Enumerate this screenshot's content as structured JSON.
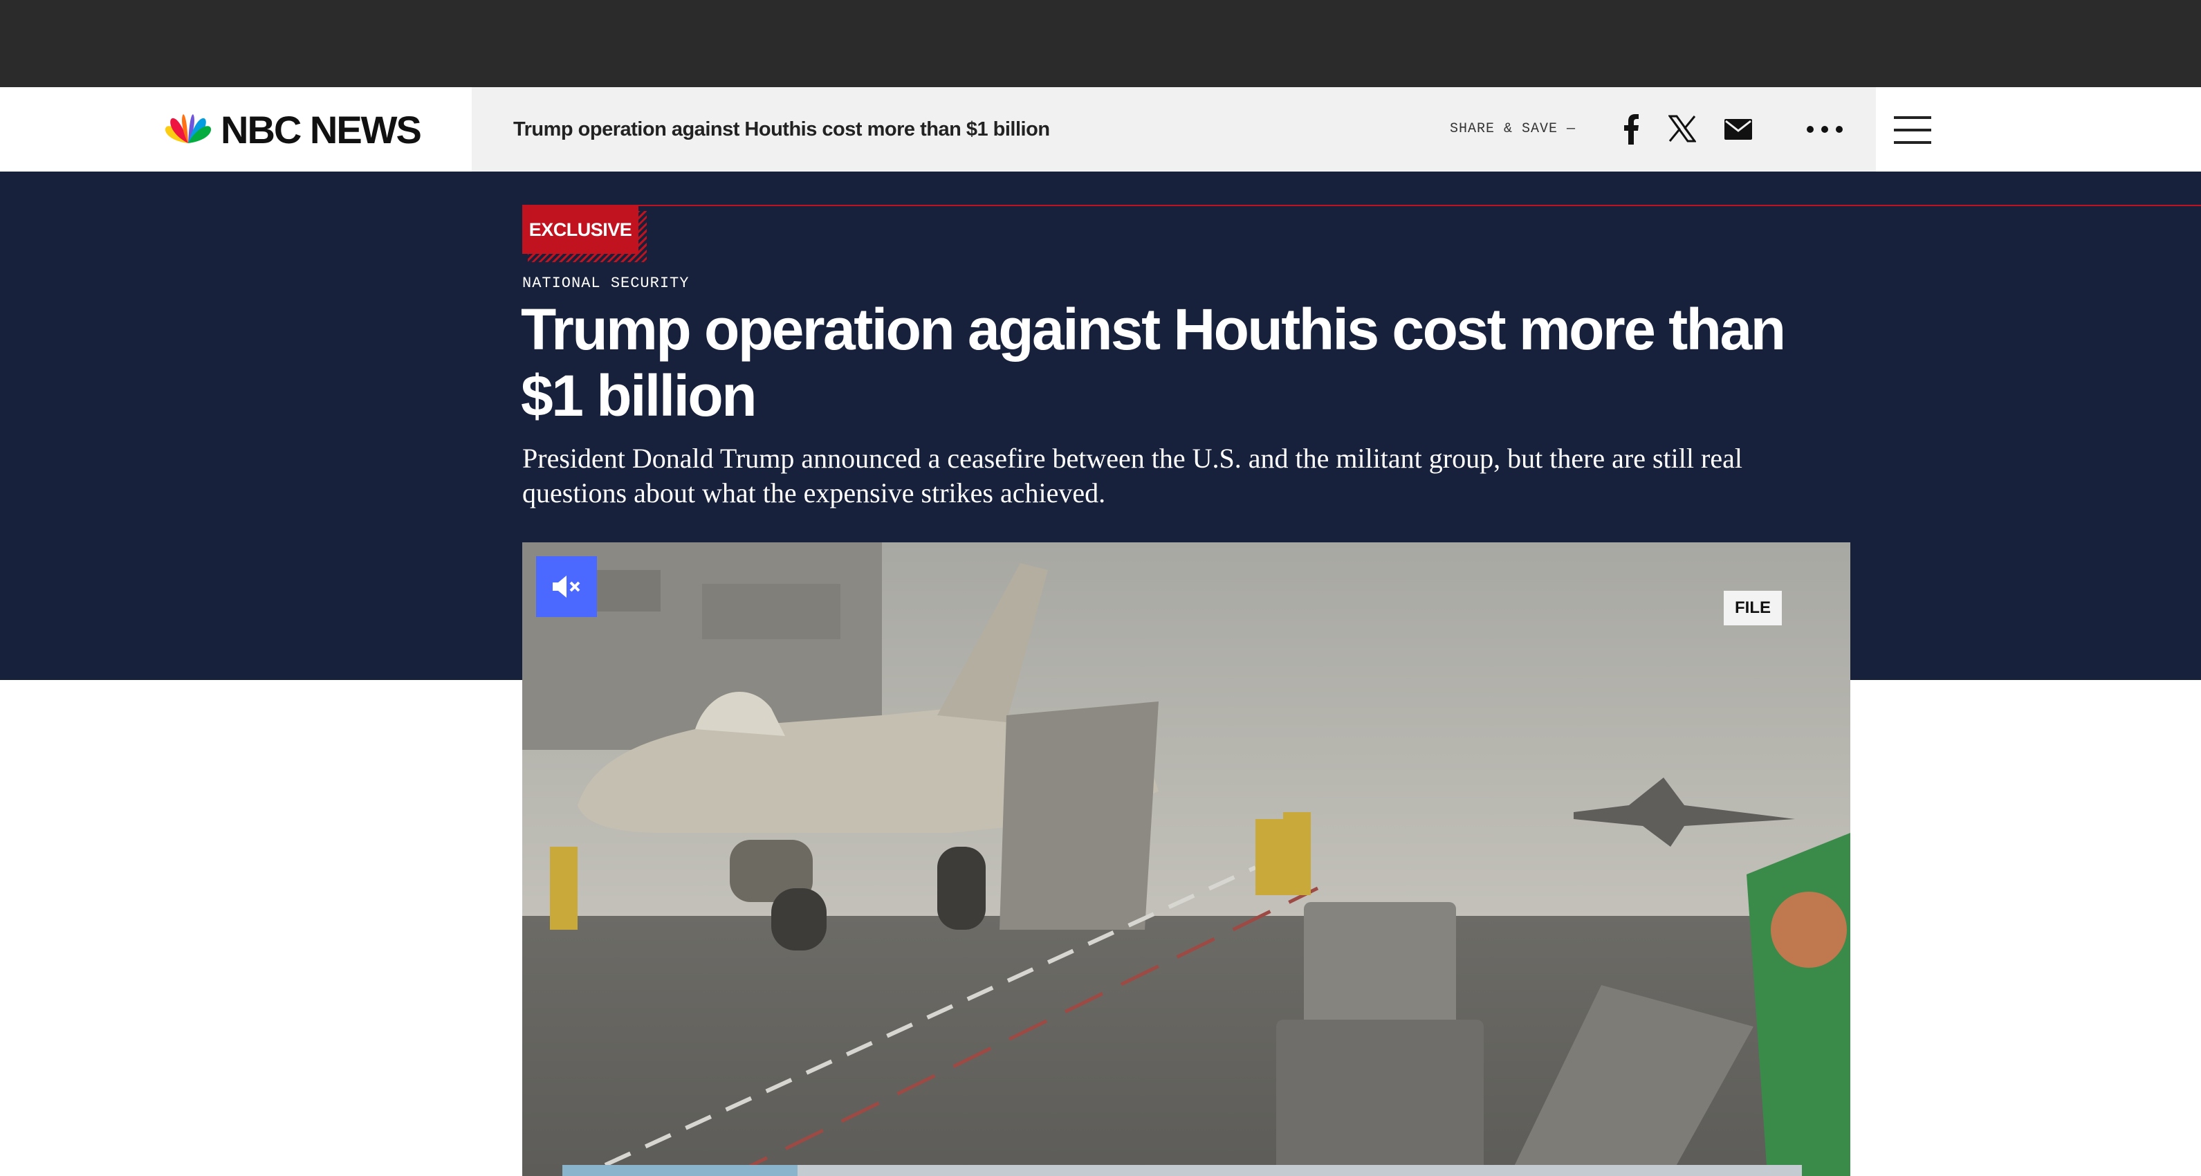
{
  "brand": {
    "name": "NBC NEWS"
  },
  "sticky_bar": {
    "title": "Trump operation against Houthis cost more than $1 billion",
    "share_label": "SHARE & SAVE —"
  },
  "share_icons": [
    "facebook-icon",
    "x-icon",
    "mail-icon",
    "more-icon"
  ],
  "article": {
    "badge": "EXCLUSIVE",
    "kicker": "NATIONAL SECURITY",
    "headline": "Trump operation against Houthis cost more than $1 billion",
    "dek": "President Donald Trump announced a ceasefire between the U.S. and the militant group, but there are still real questions about what the expensive strikes achieved."
  },
  "video": {
    "tag": "FILE",
    "progress": 0.19
  },
  "colors": {
    "topbar": "#2b2b2b",
    "hero_bg": "#18213b",
    "accent_red": "#c1121f",
    "mute_button": "#4b68ff"
  }
}
